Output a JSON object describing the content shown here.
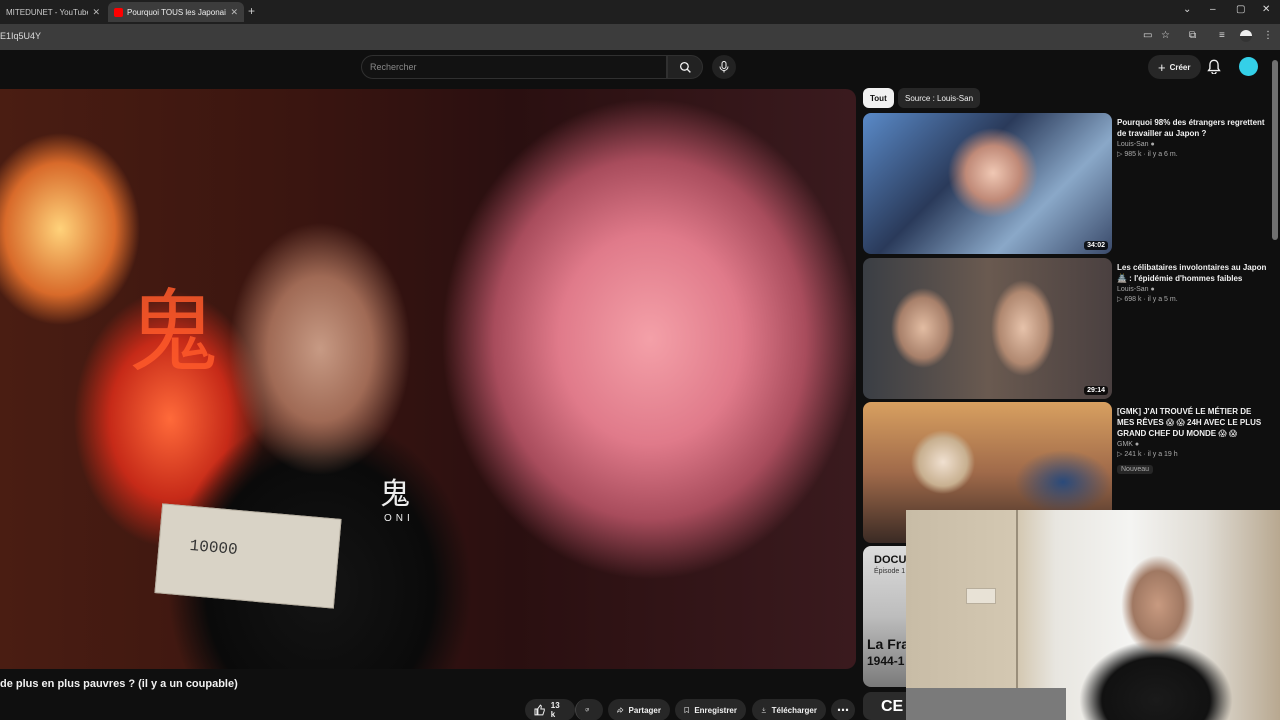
{
  "browser": {
    "tabs": [
      {
        "title": "MITEDUNET - YouTube",
        "active": false
      },
      {
        "title": "Pourquoi TOUS les Japonais so",
        "active": true
      }
    ],
    "url": "E1Iq5U4Y",
    "new_tab_icon": "plus-icon",
    "window_controls": [
      "minimize-icon",
      "maximize-icon",
      "close-icon"
    ]
  },
  "topbar": {
    "search_placeholder": "Rechercher",
    "create_label": "Créer",
    "avatar_color": "#34d0e8"
  },
  "video": {
    "title": "de plus en plus pauvres ? (il y a un coupable)",
    "shirt_logo": "鬼",
    "shirt_text": "ONI",
    "banknote_value": "10000",
    "actions": {
      "likes": "13 k",
      "share": "Partager",
      "save": "Enregistrer",
      "download": "Télécharger"
    }
  },
  "sidebar": {
    "chips": [
      "Tout",
      "Source : Louis-San"
    ],
    "recommendations": [
      {
        "title": "Pourquoi 98% des étrangers regrettent de travailler au Japon ?",
        "channel": "Louis-San",
        "views": "985 k",
        "age": "il y a 6 m.",
        "duration": "34:02"
      },
      {
        "title": "Les célibataires involontaires au Japon 🏯 : l'épidémie d'hommes faibles",
        "channel": "Louis-San",
        "views": "698 k",
        "age": "il y a 5 m.",
        "duration": "29:14"
      },
      {
        "title": "[GMK] J'AI TROUVÉ LE MÉTIER DE MES RÊVES 😱 😱 24H AVEC LE PLUS GRAND CHEF DU MONDE 😱 😱",
        "channel": "GMK",
        "views": "241 k",
        "age": "il y a 19 h",
        "badge": "Nouveau"
      },
      {
        "thumb_lines": [
          "DOCUM",
          "Épisode 1",
          "La Fra",
          "1944-1"
        ]
      },
      {
        "thumb_lines": [
          "CE"
        ]
      }
    ]
  }
}
